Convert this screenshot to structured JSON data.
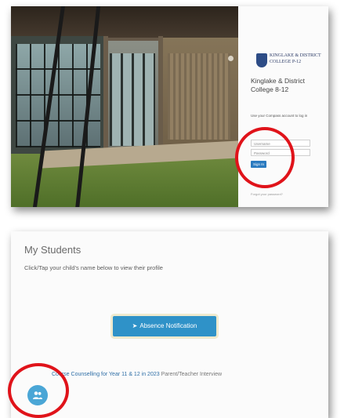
{
  "login_screen": {
    "logo_text": [
      "KINGLAKE & DISTRICT",
      "COLLEGE P-12"
    ],
    "college_name": "Kinglake & District College 8-12",
    "caption": "Use your Compass account to log in",
    "username_placeholder": "Username",
    "password_placeholder": "Password",
    "signin_label": "Sign In",
    "footer": "Forgot your password?",
    "icons": [
      "school-logo-icon"
    ]
  },
  "portal_screen": {
    "title": "My Students",
    "subtitle": "Click/Tap your child's name below to view their profile",
    "notification_button": "Absence Notification",
    "link_text": "Course Counselling for Year 11 & 12 in 2023",
    "link_suffix": "Parent/Teacher Interview",
    "icons": [
      "arrow-right-icon",
      "people-icon"
    ],
    "fab_color": "#4aa6d6",
    "accent_color": "#2f92c8"
  },
  "annotation": {
    "ring_color": "#e0131a"
  }
}
